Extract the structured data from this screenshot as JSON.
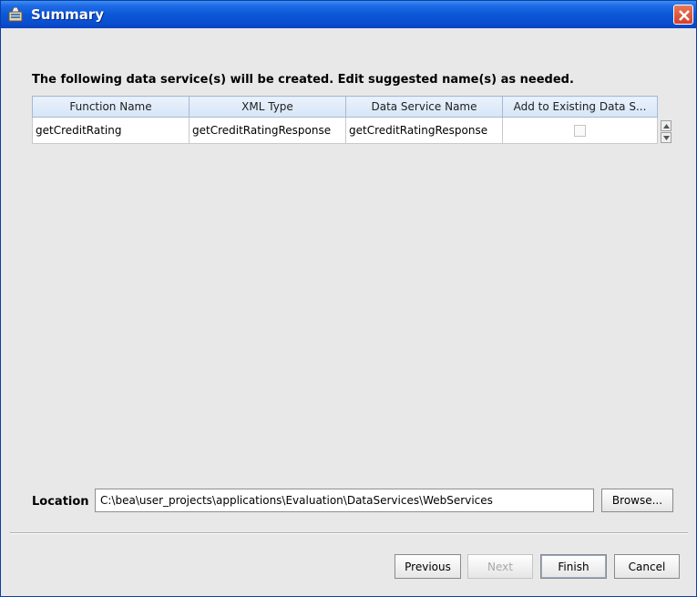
{
  "window": {
    "title": "Summary",
    "title_icon": "wizard-icon",
    "close_icon": "close-icon"
  },
  "heading": "The following data service(s) will be created.  Edit suggested name(s) as needed.",
  "table": {
    "columns": [
      "Function Name",
      "XML Type",
      "Data Service Name",
      "Add to Existing Data S..."
    ],
    "rows": [
      {
        "function_name": "getCreditRating",
        "xml_type": "getCreditRatingResponse",
        "data_service_name": "getCreditRatingResponse",
        "add_to_existing": false
      }
    ]
  },
  "location": {
    "label": "Location",
    "value": "C:\\bea\\user_projects\\applications\\Evaluation\\DataServices\\WebServices",
    "browse_label": "Browse..."
  },
  "buttons": {
    "previous": "Previous",
    "next": "Next",
    "finish": "Finish",
    "cancel": "Cancel"
  },
  "colors": {
    "titlebar": "#0a58d8",
    "header": "#d6e5f7",
    "background": "#e8e8e8"
  }
}
